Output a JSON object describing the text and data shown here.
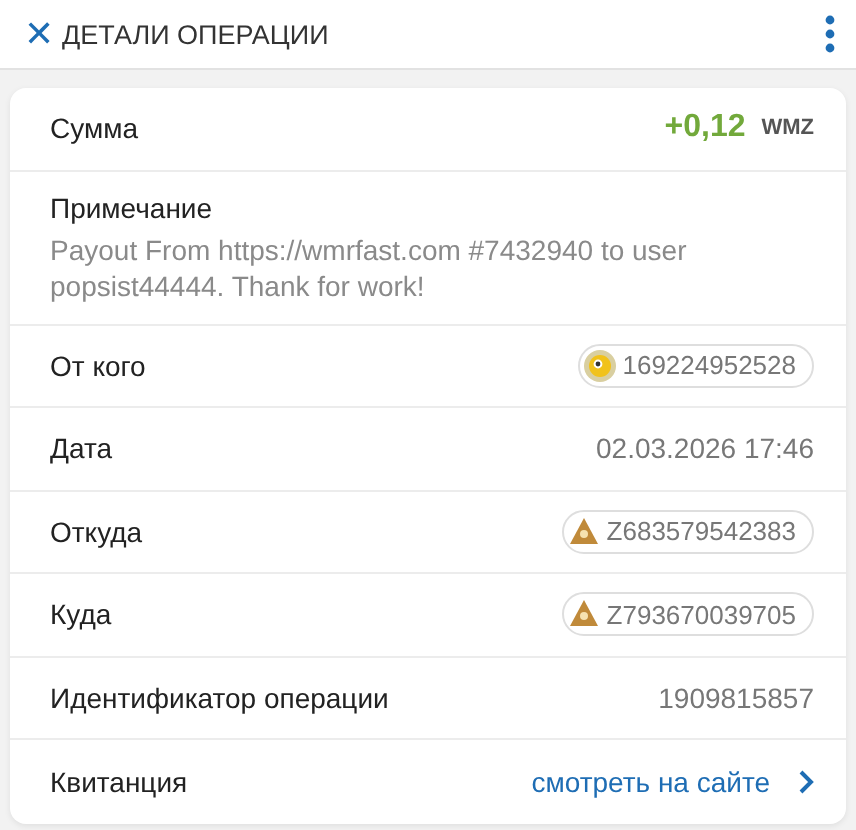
{
  "header": {
    "close_glyph": "✕",
    "title": "ДЕТАЛИ ОПЕРАЦИИ"
  },
  "rows": [
    {
      "kind": "amount",
      "label": "Сумма",
      "value": "+0,12",
      "unit": "WMZ"
    },
    {
      "kind": "note",
      "label": "Примечание",
      "value": "Payout From https://wmrfast.com #7432940 to user popsist44444. Thank for work!"
    },
    {
      "kind": "user",
      "label": "От кого",
      "value": "169224952528"
    },
    {
      "kind": "text",
      "label": "Дата",
      "value": "02.03.2026 17:46"
    },
    {
      "kind": "purse",
      "label": "Откуда",
      "value": "Z683579542383"
    },
    {
      "kind": "purse",
      "label": "Куда",
      "value": "Z793670039705"
    },
    {
      "kind": "text",
      "label": "Идентификатор операции",
      "value": "1909815857"
    },
    {
      "kind": "link",
      "label": "Квитанция",
      "value": "смотреть на сайте"
    }
  ]
}
